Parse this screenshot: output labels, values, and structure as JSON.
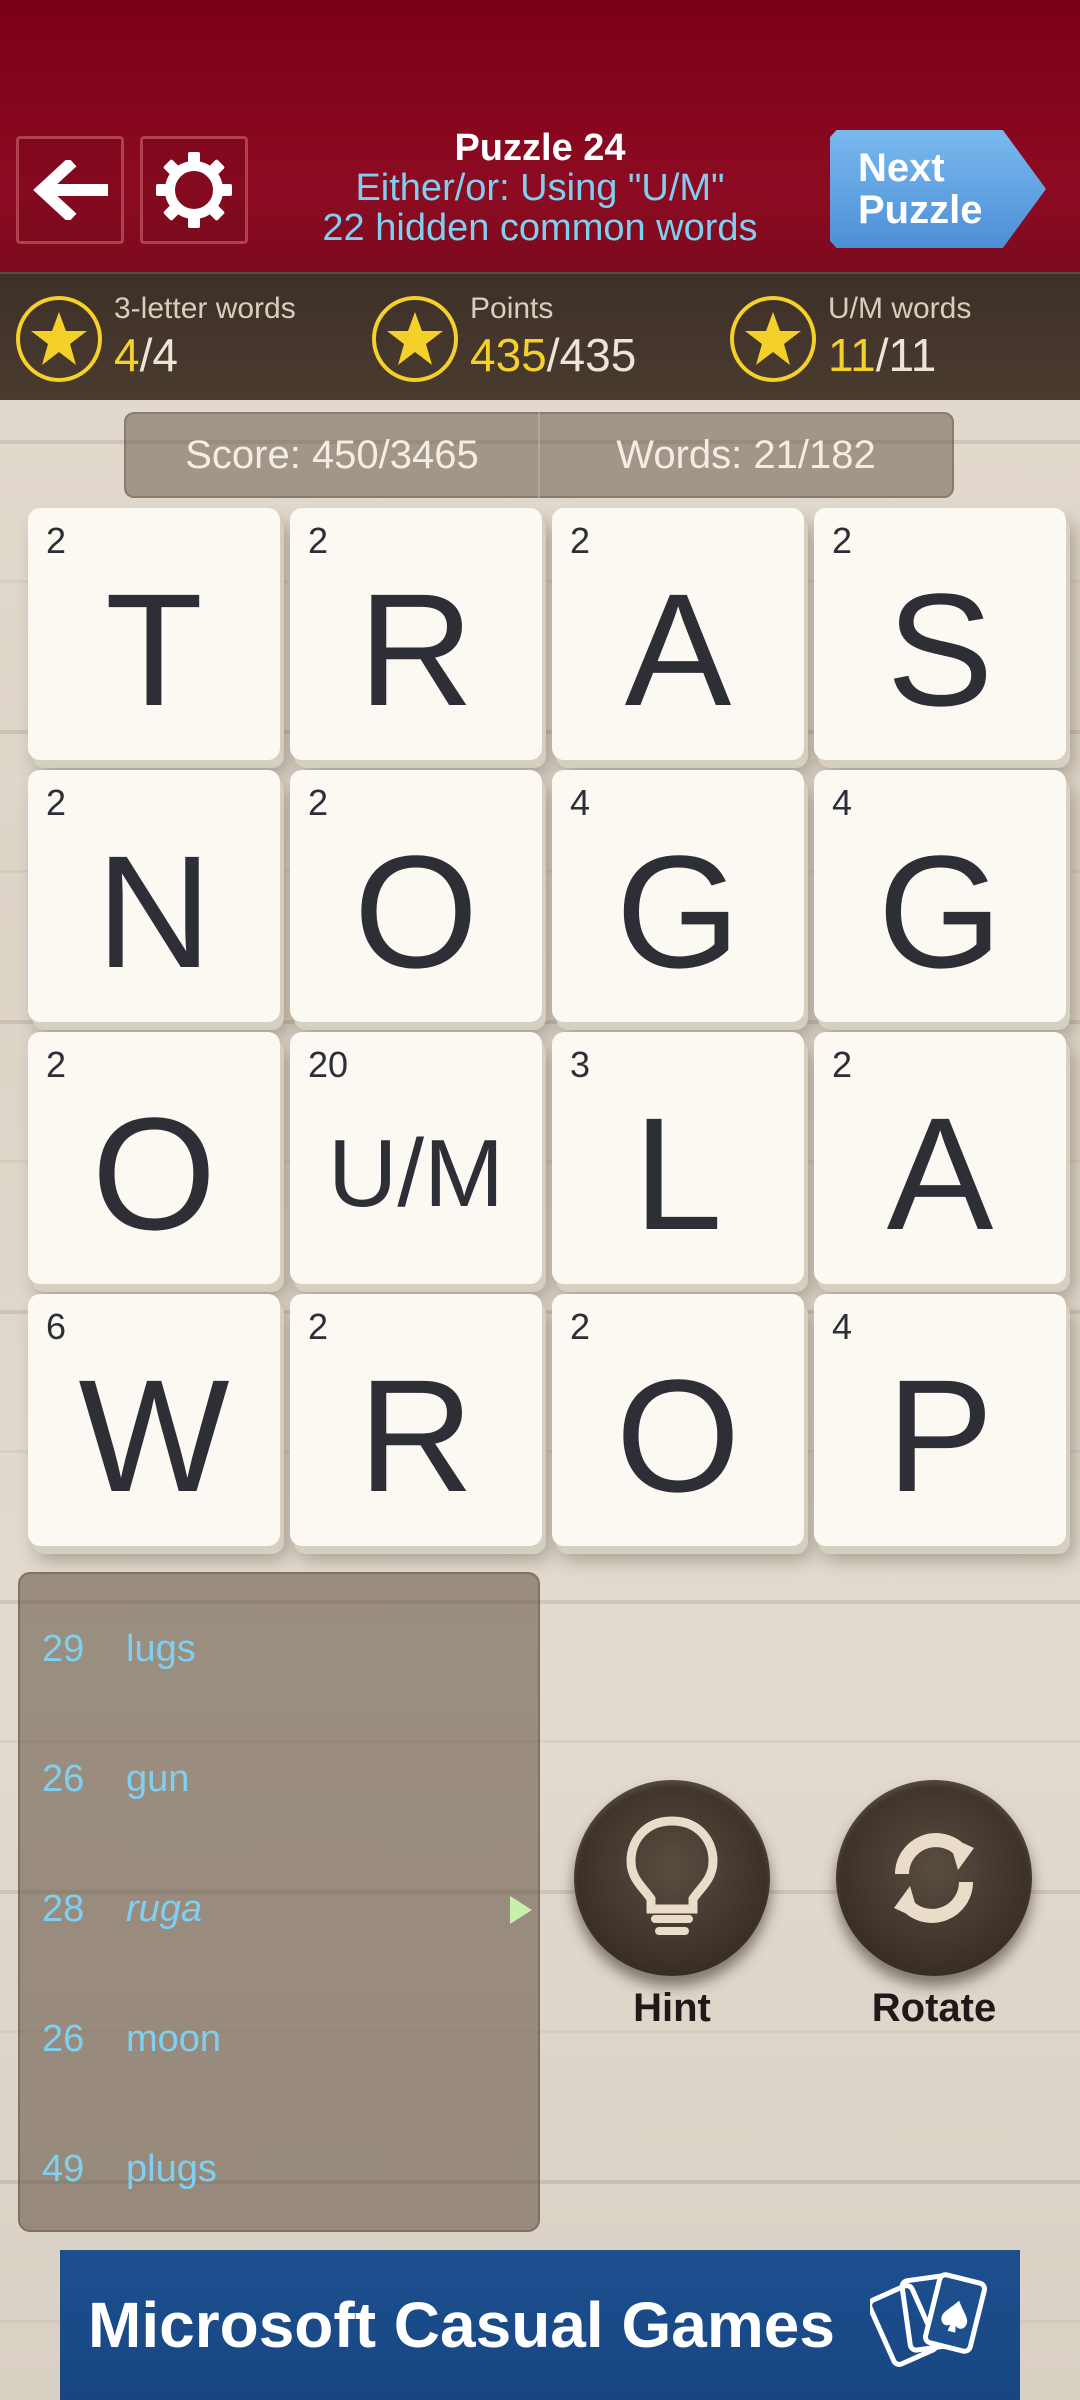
{
  "header": {
    "title": "Puzzle 24",
    "subtitle_line1": "Either/or: Using \"U/M\"",
    "subtitle_line2": "22 hidden common words",
    "next_line1": "Next",
    "next_line2": "Puzzle",
    "back_icon": "back-arrow-icon",
    "settings_icon": "gear-icon",
    "background_color": "#8d0b22"
  },
  "goals": [
    {
      "label": "3-letter words",
      "current": "4",
      "total": "/4"
    },
    {
      "label": "Points",
      "current": "435",
      "total": "/435"
    },
    {
      "label": "U/M words",
      "current": "11",
      "total": "/11"
    }
  ],
  "scorebar": {
    "score": "Score: 450/3465",
    "words": "Words: 21/182"
  },
  "tiles": [
    {
      "points": "2",
      "letter": "T"
    },
    {
      "points": "2",
      "letter": "R"
    },
    {
      "points": "2",
      "letter": "A"
    },
    {
      "points": "2",
      "letter": "S"
    },
    {
      "points": "2",
      "letter": "N"
    },
    {
      "points": "2",
      "letter": "O"
    },
    {
      "points": "4",
      "letter": "G"
    },
    {
      "points": "4",
      "letter": "G"
    },
    {
      "points": "2",
      "letter": "O"
    },
    {
      "points": "20",
      "letter": "U/M"
    },
    {
      "points": "3",
      "letter": "L"
    },
    {
      "points": "2",
      "letter": "A"
    },
    {
      "points": "6",
      "letter": "W"
    },
    {
      "points": "2",
      "letter": "R"
    },
    {
      "points": "2",
      "letter": "O"
    },
    {
      "points": "4",
      "letter": "P"
    }
  ],
  "wordlist": [
    {
      "score": "29",
      "word": "lugs"
    },
    {
      "score": "26",
      "word": "gun"
    },
    {
      "score": "28",
      "word": "ruga"
    },
    {
      "score": "26",
      "word": "moon"
    },
    {
      "score": "49",
      "word": "plugs"
    }
  ],
  "actions": {
    "hint_label": "Hint",
    "rotate_label": "Rotate",
    "hint_icon": "lightbulb-icon",
    "rotate_icon": "rotate-icon"
  },
  "banner": {
    "text": "Microsoft Casual Games",
    "logo_icon": "playing-cards-icon"
  }
}
